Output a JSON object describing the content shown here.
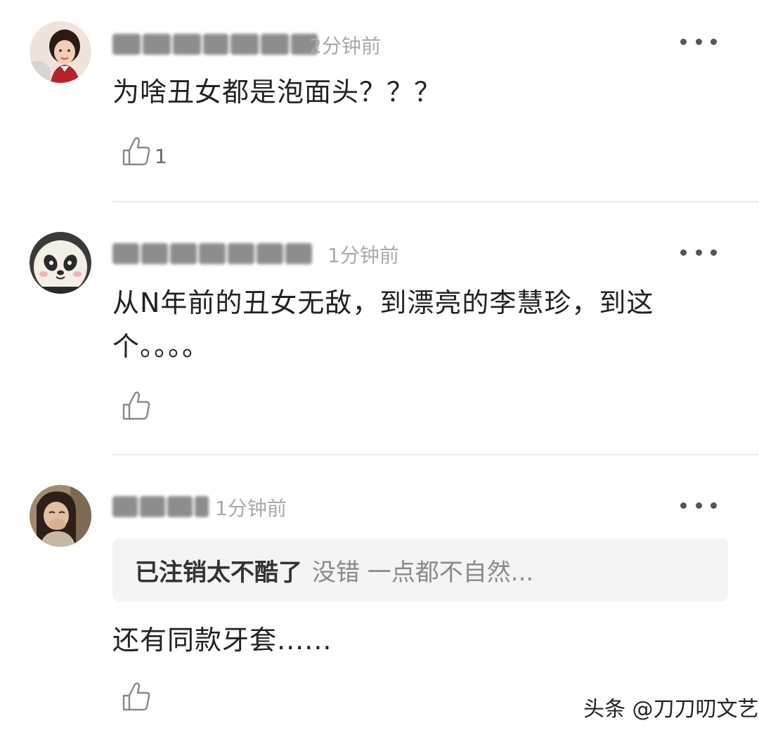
{
  "comments": [
    {
      "timestamp": "2分钟前",
      "text": "为啥丑女都是泡面头？？？",
      "likes": "1",
      "avatar": "girl-portrait-avatar"
    },
    {
      "timestamp": "1分钟前",
      "text": "从N年前的丑女无敌，到漂亮的李慧珍，到这个。。。。",
      "likes": "",
      "avatar": "panda-avatar"
    },
    {
      "timestamp": "1分钟前",
      "quote_user": "已注销太不酷了",
      "quote_text": "没错 一点都不自然...",
      "text": "还有同款牙套......",
      "likes": "",
      "avatar": "woman-laughing-avatar"
    }
  ],
  "watermark": "头条 @刀刀叨文艺",
  "colors": {
    "text": "#222222",
    "timestamp": "#a9a9a9",
    "divider": "#ececec",
    "quote_bg": "#f4f4f4",
    "quote_text": "#8a8a8a"
  }
}
